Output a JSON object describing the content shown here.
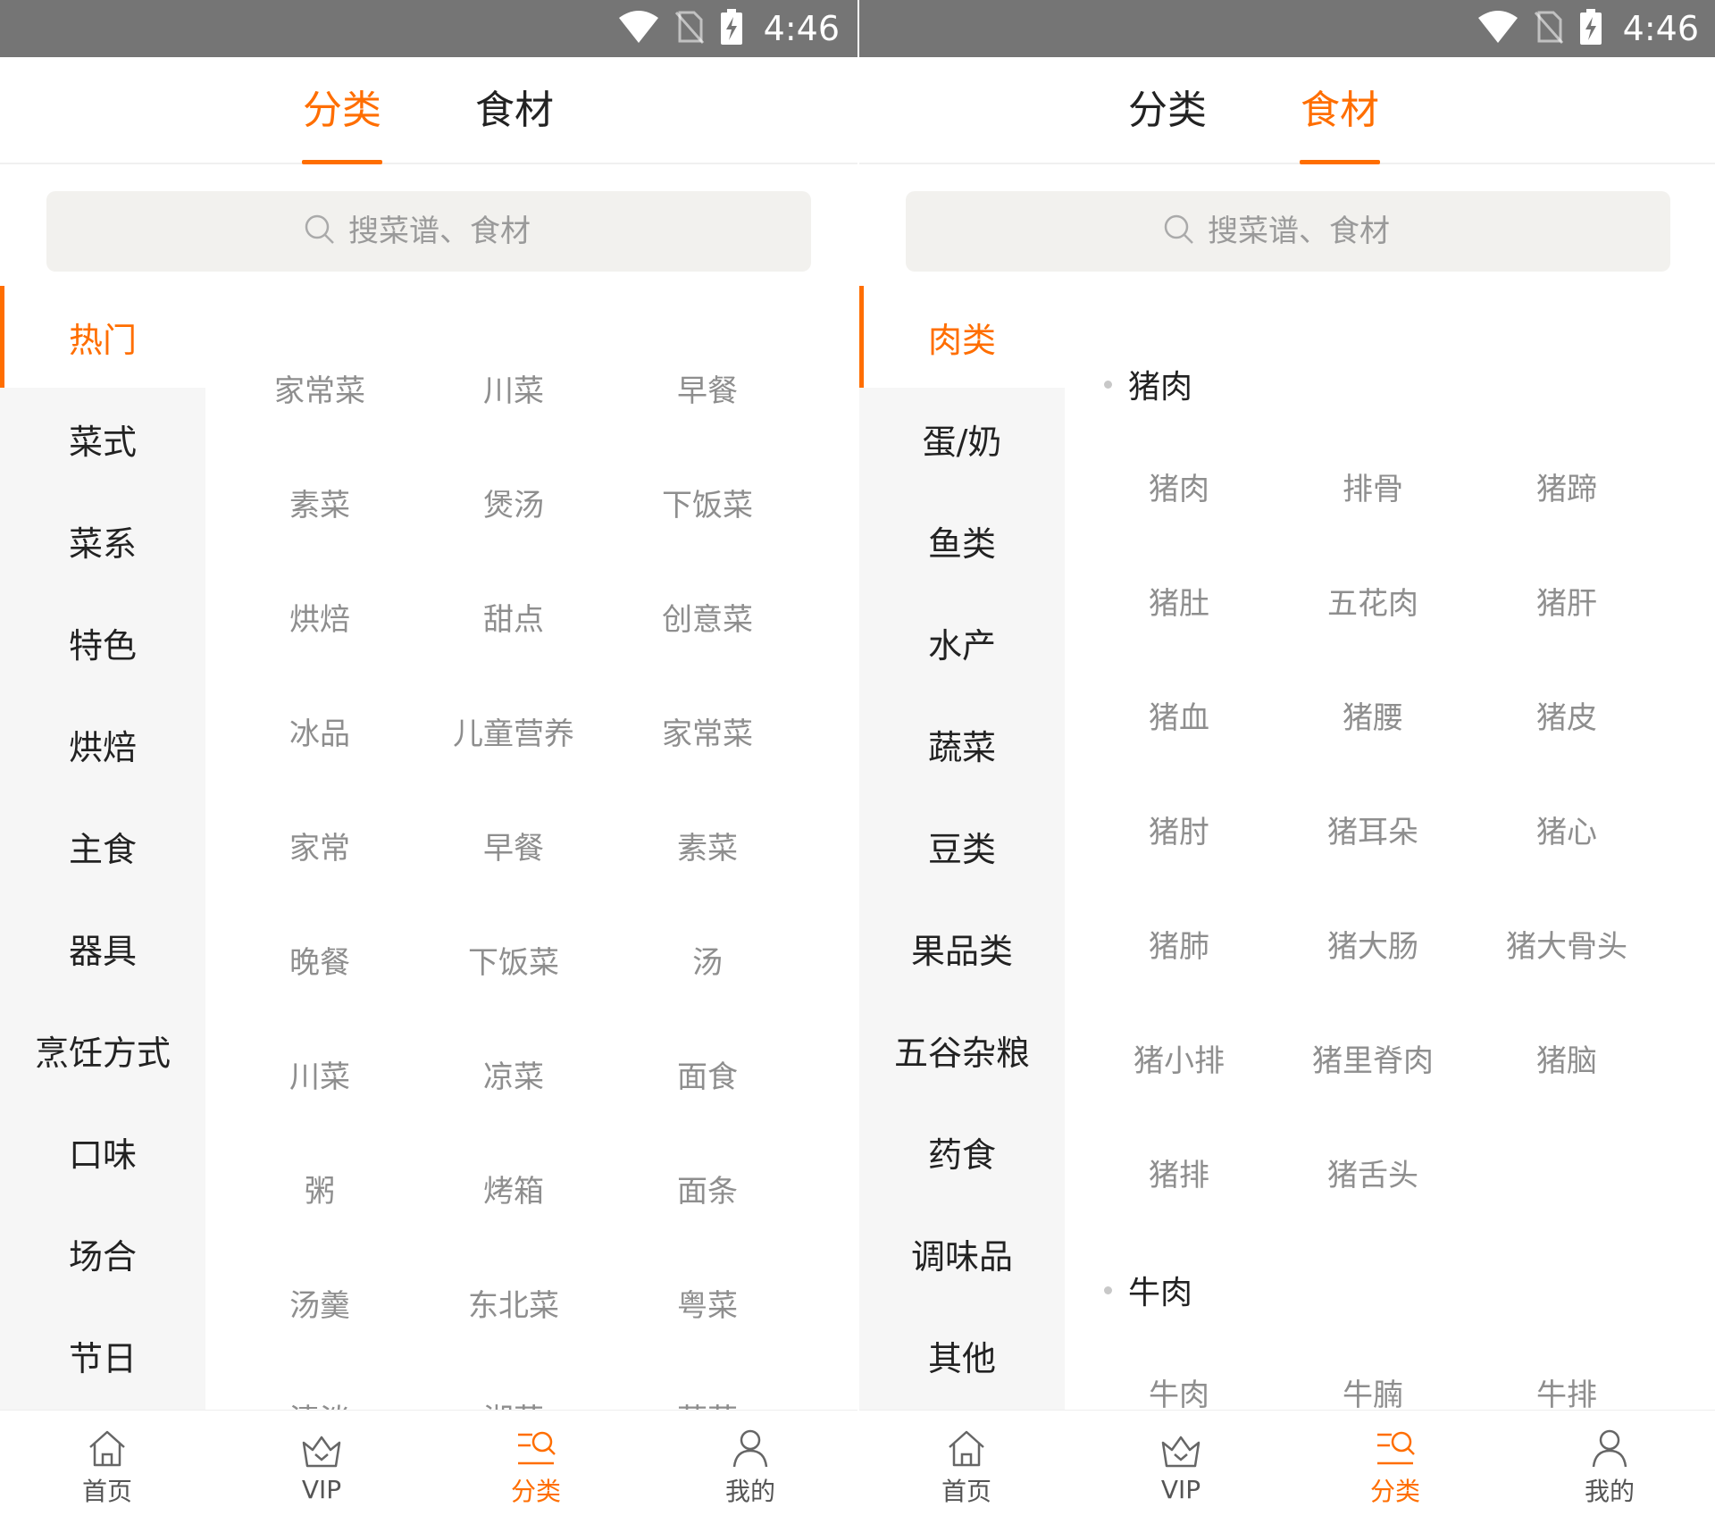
{
  "left": {
    "status": {
      "time": "4:46"
    },
    "tabs": [
      {
        "label": "分类"
      },
      {
        "label": "食材"
      }
    ],
    "search": {
      "placeholder": "搜菜谱、食材"
    },
    "sidebar": [
      {
        "label": "热门"
      },
      {
        "label": "菜式"
      },
      {
        "label": "菜系"
      },
      {
        "label": "特色"
      },
      {
        "label": "烘焙"
      },
      {
        "label": "主食"
      },
      {
        "label": "器具"
      },
      {
        "label": "烹饪方式"
      },
      {
        "label": "口味"
      },
      {
        "label": "场合"
      },
      {
        "label": "节日"
      }
    ],
    "grid": [
      [
        "家常菜",
        "川菜",
        "早餐"
      ],
      [
        "素菜",
        "煲汤",
        "下饭菜"
      ],
      [
        "烘焙",
        "甜点",
        "创意菜"
      ],
      [
        "冰品",
        "儿童营养",
        "家常菜"
      ],
      [
        "家常",
        "早餐",
        "素菜"
      ],
      [
        "晚餐",
        "下饭菜",
        "汤"
      ],
      [
        "川菜",
        "凉菜",
        "面食"
      ],
      [
        "粥",
        "烤箱",
        "面条"
      ],
      [
        "汤羹",
        "东北菜",
        "粤菜"
      ],
      [
        "清淡",
        "湘菜",
        "蔬菜"
      ]
    ]
  },
  "right": {
    "status": {
      "time": "4:46"
    },
    "tabs": [
      {
        "label": "分类"
      },
      {
        "label": "食材"
      }
    ],
    "search": {
      "placeholder": "搜菜谱、食材"
    },
    "sidebar": [
      {
        "label": "肉类"
      },
      {
        "label": "蛋/奶"
      },
      {
        "label": "鱼类"
      },
      {
        "label": "水产"
      },
      {
        "label": "蔬菜"
      },
      {
        "label": "豆类"
      },
      {
        "label": "果品类"
      },
      {
        "label": "五谷杂粮"
      },
      {
        "label": "药食"
      },
      {
        "label": "调味品"
      },
      {
        "label": "其他"
      }
    ],
    "sections": [
      {
        "title": "猪肉",
        "items": [
          [
            "猪肉",
            "排骨",
            "猪蹄"
          ],
          [
            "猪肚",
            "五花肉",
            "猪肝"
          ],
          [
            "猪血",
            "猪腰",
            "猪皮"
          ],
          [
            "猪肘",
            "猪耳朵",
            "猪心"
          ],
          [
            "猪肺",
            "猪大肠",
            "猪大骨头"
          ],
          [
            "猪小排",
            "猪里脊肉",
            "猪脑"
          ],
          [
            "猪排",
            "猪舌头"
          ]
        ]
      },
      {
        "title": "牛肉",
        "items": [
          [
            "牛肉",
            "牛腩",
            "牛排"
          ]
        ]
      }
    ]
  },
  "bottomnav": [
    {
      "label": "首页",
      "icon": "home-icon"
    },
    {
      "label": "VIP",
      "icon": "crown-icon"
    },
    {
      "label": "分类",
      "icon": "category-icon"
    },
    {
      "label": "我的",
      "icon": "user-icon"
    }
  ],
  "colors": {
    "accent": "#ff6e00",
    "statusbar": "#757575",
    "sidebar": "#f6f6f6",
    "search": "#f2f1ee"
  }
}
